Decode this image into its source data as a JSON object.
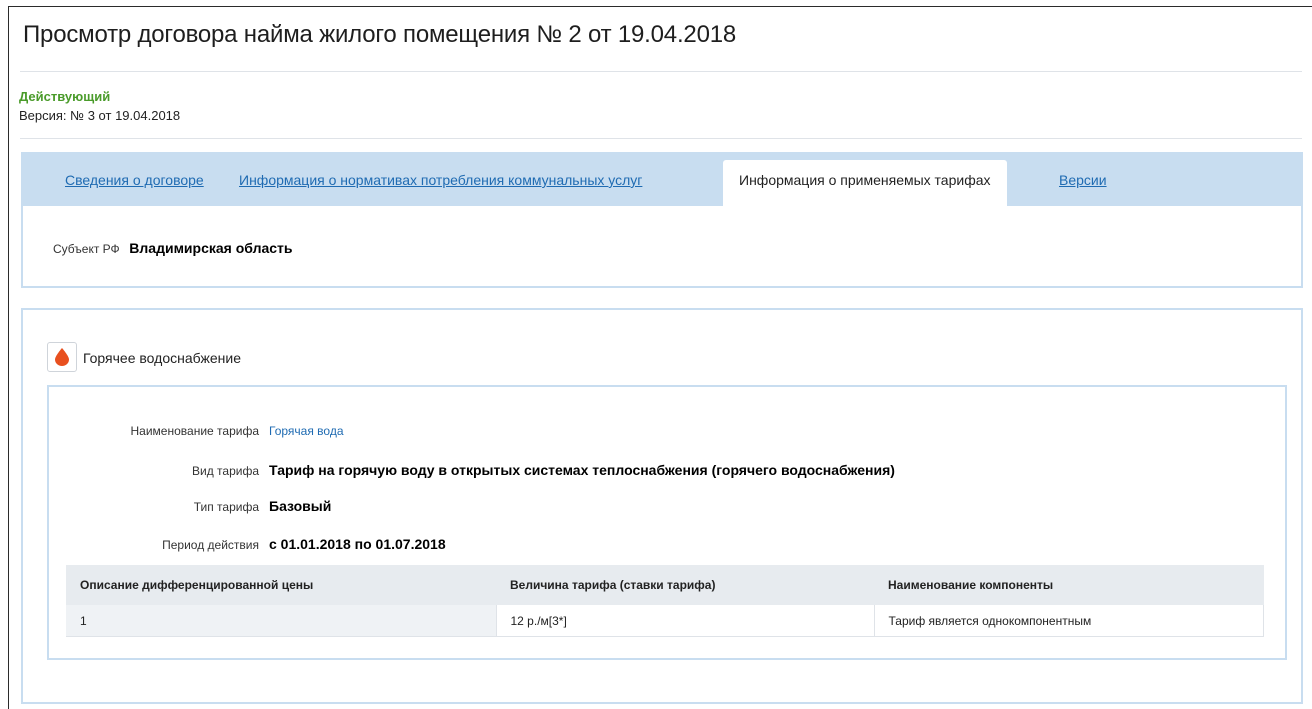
{
  "page": {
    "title": "Просмотр договора найма жилого помещения № 2 от 19.04.2018",
    "status": "Действующий",
    "version": "Версия: № 3 от 19.04.2018"
  },
  "tabs": [
    {
      "label": "Сведения о договоре",
      "active": false
    },
    {
      "label": "Информация о нормативах потребления коммунальных услуг",
      "active": false
    },
    {
      "label": "Информация о применяемых тарифах",
      "active": true
    },
    {
      "label": "Версии",
      "active": false
    }
  ],
  "subject": {
    "label": "Субъект РФ",
    "value": "Владимирская область"
  },
  "service": {
    "icon": "water-drop-icon",
    "title": "Горячее водоснабжение",
    "fields": {
      "tariff_name_label": "Наименование тарифа",
      "tariff_name_value": "Горячая вода",
      "tariff_kind_label": "Вид тарифа",
      "tariff_kind_value": "Тариф на горячую воду в открытых системах теплоснабжения (горячего водоснабжения)",
      "tariff_type_label": "Тип тарифа",
      "tariff_type_value": "Базовый",
      "period_label": "Период действия",
      "period_value": "с 01.01.2018 по 01.07.2018"
    },
    "table": {
      "headers": [
        "Описание дифференцированной цены",
        "Величина тарифа (ставки тарифа)",
        "Наименование компоненты"
      ],
      "rows": [
        [
          "1",
          "12 р./м[3*]",
          "Тариф является однокомпонентным"
        ]
      ]
    }
  },
  "colors": {
    "accent": "#1f6bb2",
    "status_green": "#4a9b2a",
    "panel_border": "#c8ddf0",
    "drop_red": "#e8501f"
  }
}
